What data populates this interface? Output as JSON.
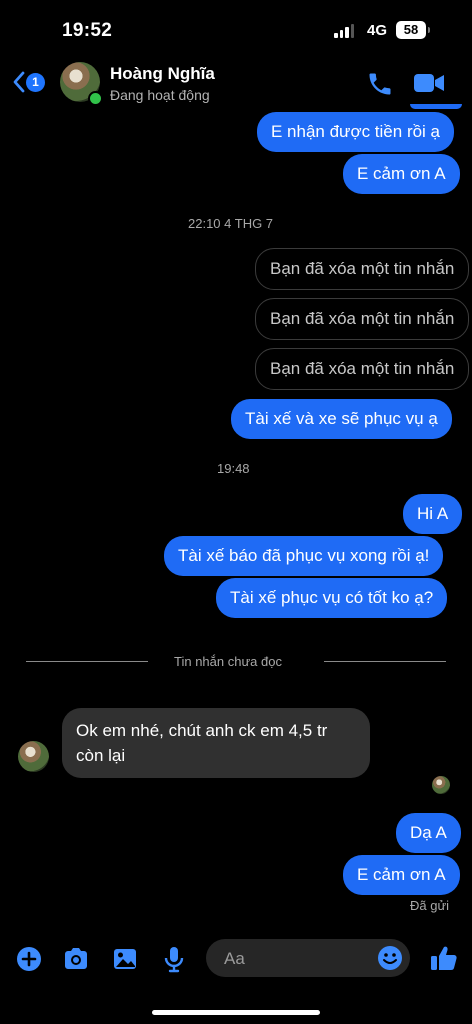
{
  "status_bar": {
    "time": "19:52",
    "network": "4G",
    "battery": "58"
  },
  "header": {
    "unread_count": "1",
    "contact_name": "Hoàng Nghĩa",
    "contact_status": "Đang hoạt động"
  },
  "messages": {
    "m1": "E nhận được tiền rồi ạ",
    "m2": "E cảm ơn A",
    "ts1": "22:10 4 THG 7",
    "del1": "Bạn đã xóa một tin nhắn",
    "del2": "Bạn đã xóa một tin nhắn",
    "del3": "Bạn đã xóa một tin nhắn",
    "m3": "Tài xế và xe sẽ phục vụ ạ",
    "ts2": "19:48",
    "m4": "Hi A",
    "m5": "Tài xế báo đã phục vụ xong rồi ạ!",
    "m6": "Tài xế phục vụ có tốt ko ạ?",
    "unread_divider": "Tin nhắn chưa đọc",
    "in1": "Ok em nhé, chút anh ck em 4,5 tr còn lại",
    "m7": "Dạ A",
    "m8": "E cảm ơn A",
    "delivery_status": "Đã gửi"
  },
  "composer": {
    "placeholder": "Aa"
  },
  "icons": {
    "back": "chevron-left-icon",
    "call": "phone-icon",
    "video": "video-camera-icon",
    "add": "plus-circle-icon",
    "camera": "camera-icon",
    "gallery": "image-icon",
    "voice": "microphone-icon",
    "emoji": "emoji-icon",
    "like": "thumbs-up-icon"
  },
  "colors": {
    "accent": "#1f6bf5",
    "icon_blue": "#3d8bfd",
    "online": "#31c24a"
  }
}
